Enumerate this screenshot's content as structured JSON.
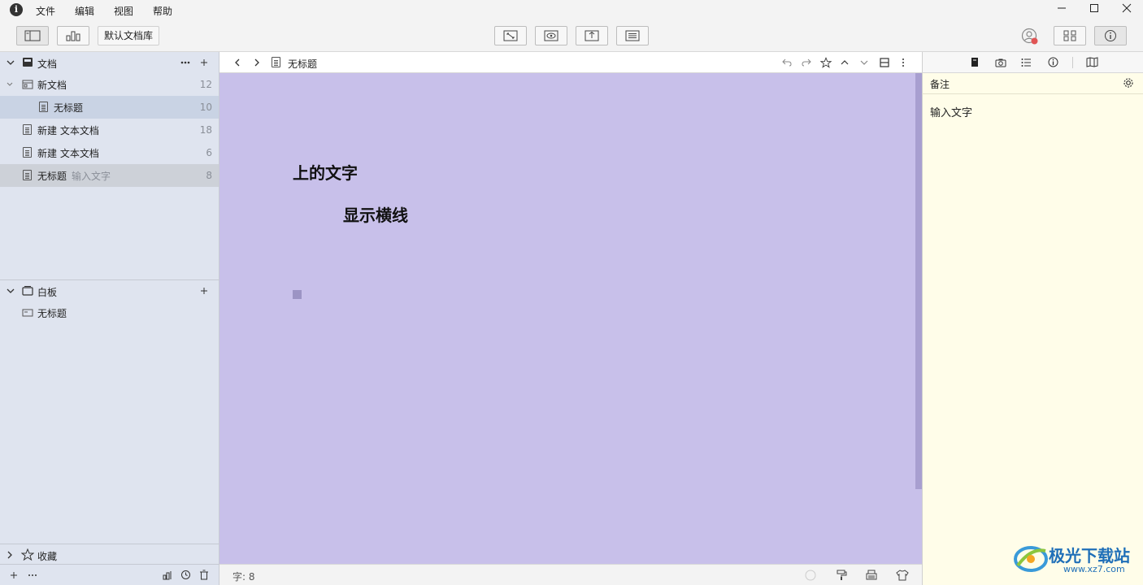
{
  "menu": {
    "items": [
      "文件",
      "编辑",
      "视图",
      "帮助"
    ]
  },
  "toolbar": {
    "library_label": "默认文档库"
  },
  "sidebar": {
    "docs_header": "文档",
    "docs": [
      {
        "label": "新文档",
        "count": "12",
        "type": "folder"
      },
      {
        "label": "无标题",
        "count": "10",
        "type": "doc"
      },
      {
        "label": "新建 文本文档",
        "count": "18",
        "type": "doc"
      },
      {
        "label": "新建 文本文档",
        "count": "6",
        "type": "doc"
      },
      {
        "label": "无标题",
        "sub": "输入文字",
        "count": "8",
        "type": "doc"
      }
    ],
    "board_header": "白板",
    "boards": [
      {
        "label": "无标题"
      }
    ],
    "favorites_label": "收藏"
  },
  "editor": {
    "breadcrumb_title": "无标题",
    "line1": "上的文字",
    "line2": "显示横线",
    "background": "#c8c0ea"
  },
  "status": {
    "word_count": "字: 8"
  },
  "right_panel": {
    "section_title": "备注",
    "note_text": "输入文字",
    "background": "#fffde9"
  },
  "watermark": {
    "brand": "极光下载站",
    "url": "www.xz7.com"
  }
}
